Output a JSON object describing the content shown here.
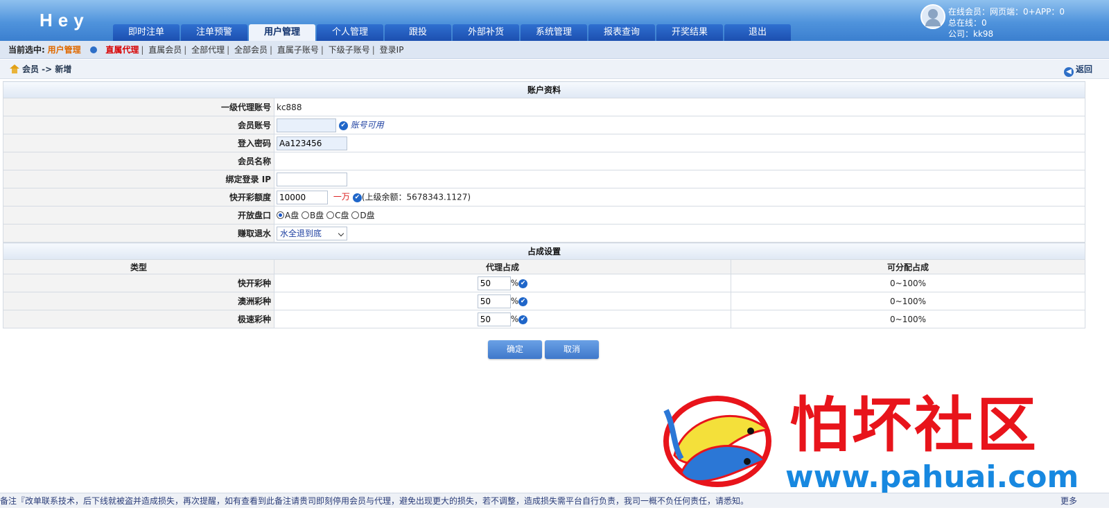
{
  "header": {
    "logo": "Hey",
    "nav": [
      "即时注单",
      "注单预警",
      "用户管理",
      "个人管理",
      "跟投",
      "外部补货",
      "系统管理",
      "报表查询",
      "开奖结果",
      "退出"
    ],
    "active_nav": 2,
    "online_line1": "在线会员：网页端：0+APP：0",
    "online_line2": "总在线：0",
    "online_line3": "公司：kk98"
  },
  "subnav": {
    "label": "当前选中:",
    "module": "用户管理",
    "current": "直属代理",
    "links": [
      "直属会员",
      "全部代理",
      "全部会员",
      "直属子账号",
      "下级子账号",
      "登录IP"
    ]
  },
  "path": {
    "text": "会员 -> 新增",
    "back": "返回"
  },
  "account": {
    "section_title": "账户资料",
    "agent_label": "一级代理账号",
    "agent_value": "kc888",
    "member_label": "会员账号",
    "member_ok": "账号可用",
    "password_label": "登入密码",
    "password_value": "Aa123456",
    "name_label": "会员名称",
    "ip_label": "绑定登录 IP",
    "quota_label": "快开彩额度",
    "quota_value": "10000",
    "quota_unit": "一万",
    "quota_balance": "(上级余额：5678343.1127)",
    "pan_label": "开放盘口",
    "pan_options": [
      "A盘",
      "B盘",
      "C盘",
      "D盘"
    ],
    "pan_selected": 0,
    "rebate_label": "赚取退水",
    "rebate_value": "水全退到底"
  },
  "share": {
    "section_title": "占成设置",
    "col_type": "类型",
    "col_agent": "代理占成",
    "col_avail": "可分配占成",
    "rows": [
      {
        "type": "快开彩种",
        "value": "50",
        "pct": "%",
        "range": "0~100%"
      },
      {
        "type": "澳洲彩种",
        "value": "50",
        "pct": "%",
        "range": "0~100%"
      },
      {
        "type": "极速彩种",
        "value": "50",
        "pct": "%",
        "range": "0~100%"
      }
    ]
  },
  "buttons": {
    "confirm": "确定",
    "cancel": "取消"
  },
  "watermark": {
    "cn": "怕坏社区",
    "url": "www.pahuai.com"
  },
  "footer": {
    "notice": "备注『改单联系技术，后下线就被盗并造成损失，再次提醒，如有查看到此备注请贵司即刻停用会员与代理，避免出现更大的损失，若不调整，造成损失需平台自行负责，我司一概不负任何责任，请悉知。",
    "more": "更多"
  }
}
